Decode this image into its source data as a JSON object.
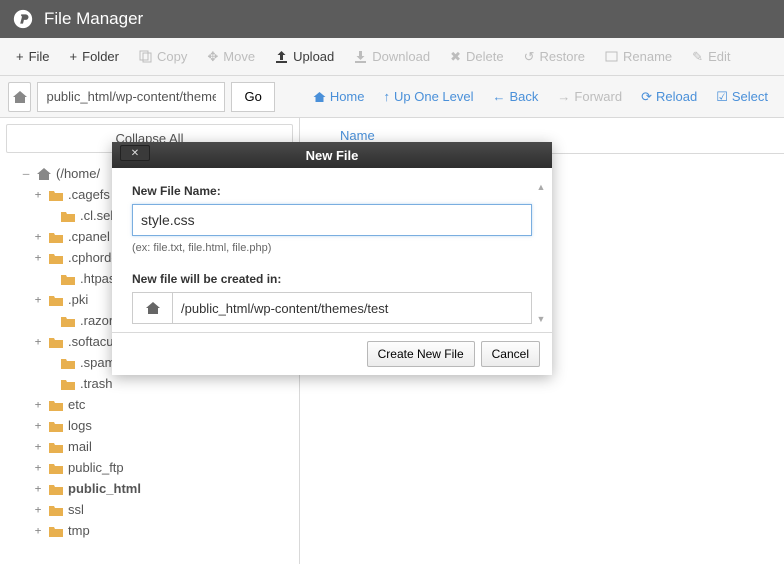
{
  "header": {
    "title": "File Manager"
  },
  "toolbar": {
    "file": "File",
    "folder": "Folder",
    "copy": "Copy",
    "move": "Move",
    "upload": "Upload",
    "download": "Download",
    "delete": "Delete",
    "restore": "Restore",
    "rename": "Rename",
    "edit": "Edit"
  },
  "nav": {
    "path": "public_html/wp-content/themes",
    "go": "Go",
    "home": "Home",
    "up": "Up One Level",
    "back": "Back",
    "forward": "Forward",
    "reload": "Reload",
    "selectall": "Select"
  },
  "sidebar": {
    "collapse": "Collapse All",
    "root": "(/home/",
    "items": [
      {
        "label": ".cagefs",
        "expandable": true,
        "depth": 1
      },
      {
        "label": ".cl.selec",
        "expandable": false,
        "depth": 2
      },
      {
        "label": ".cpanel",
        "expandable": true,
        "depth": 1
      },
      {
        "label": ".cphorde",
        "expandable": true,
        "depth": 1
      },
      {
        "label": ".htpassw",
        "expandable": false,
        "depth": 2
      },
      {
        "label": ".pki",
        "expandable": true,
        "depth": 1
      },
      {
        "label": ".razor",
        "expandable": false,
        "depth": 2
      },
      {
        "label": ".softaculo",
        "expandable": true,
        "depth": 1
      },
      {
        "label": ".spamas",
        "expandable": false,
        "depth": 2
      },
      {
        "label": ".trash",
        "expandable": false,
        "depth": 2
      },
      {
        "label": "etc",
        "expandable": true,
        "depth": 1
      },
      {
        "label": "logs",
        "expandable": true,
        "depth": 1
      },
      {
        "label": "mail",
        "expandable": true,
        "depth": 1
      },
      {
        "label": "public_ftp",
        "expandable": true,
        "depth": 1
      },
      {
        "label": "public_html",
        "expandable": true,
        "depth": 1,
        "bold": true
      },
      {
        "label": "ssl",
        "expandable": true,
        "depth": 1
      },
      {
        "label": "tmp",
        "expandable": true,
        "depth": 1
      }
    ]
  },
  "content": {
    "colName": "Name"
  },
  "modal": {
    "title": "New File",
    "nameLabel": "New File Name:",
    "nameValue": "style.css",
    "hint": "(ex: file.txt, file.html, file.php)",
    "pathLabel": "New file will be created in:",
    "pathValue": "/public_html/wp-content/themes/test",
    "create": "Create New File",
    "cancel": "Cancel"
  }
}
